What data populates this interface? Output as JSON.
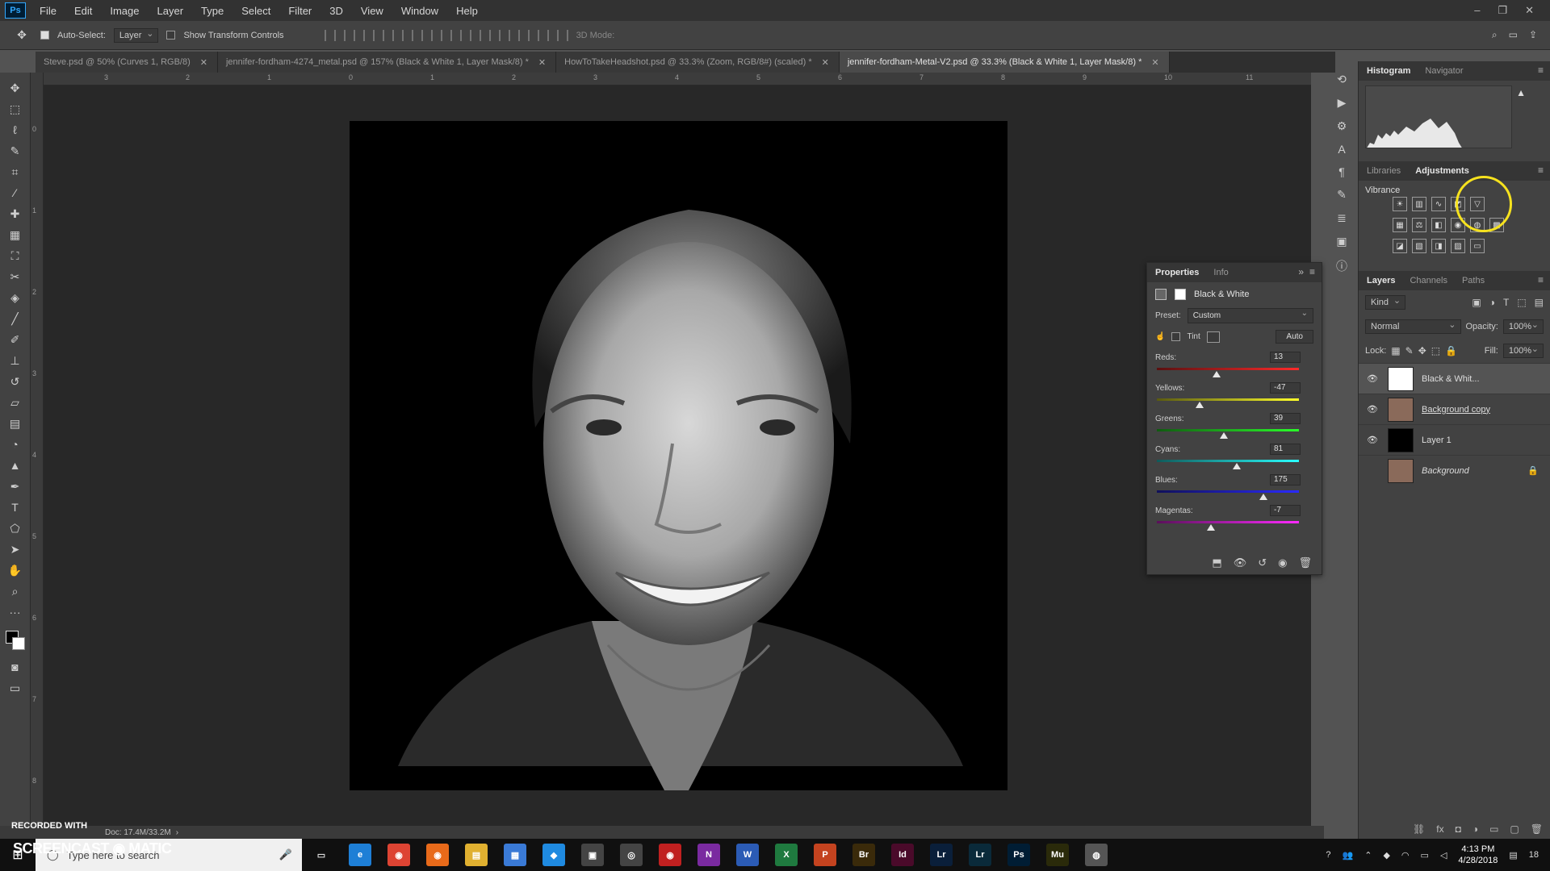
{
  "app": {
    "logo": "Ps"
  },
  "menu": [
    "File",
    "Edit",
    "Image",
    "Layer",
    "Type",
    "Select",
    "Filter",
    "3D",
    "View",
    "Window",
    "Help"
  ],
  "window_controls": [
    "–",
    "❐",
    "✕"
  ],
  "options": {
    "auto_select_label": "Auto-Select:",
    "auto_select_value": "Layer",
    "show_transform_label": "Show Transform Controls",
    "mode_3d": "3D Mode:"
  },
  "tabs": [
    {
      "label": "Steve.psd @ 50% (Curves 1, RGB/8)",
      "active": false
    },
    {
      "label": "jennifer-fordham-4274_metal.psd @ 157% (Black & White 1, Layer Mask/8) *",
      "active": false
    },
    {
      "label": "HowToTakeHeadshot.psd @ 33.3% (Zoom, RGB/8#) (scaled) *",
      "active": false
    },
    {
      "label": "jennifer-fordham-Metal-V2.psd @ 33.3% (Black & White 1, Layer Mask/8) *",
      "active": true
    }
  ],
  "ruler_h": [
    "3",
    "2",
    "1",
    "0",
    "1",
    "2",
    "3",
    "4",
    "5",
    "6",
    "7",
    "8",
    "9",
    "10",
    "11"
  ],
  "ruler_v": [
    "0",
    "1",
    "2",
    "3",
    "4",
    "5",
    "6",
    "7",
    "8"
  ],
  "status": {
    "doc": "Doc: 17.4M/33.2M"
  },
  "histogram_panel": {
    "tabs": [
      "Histogram",
      "Navigator"
    ]
  },
  "adjustments_panel": {
    "tabs": [
      "Libraries",
      "Adjustments"
    ],
    "hover_title": "Vibrance"
  },
  "layers_panel": {
    "tabs": [
      "Layers",
      "Channels",
      "Paths"
    ],
    "kind": "Kind",
    "blend": "Normal",
    "opacity_label": "Opacity:",
    "opacity_value": "100%",
    "lock_label": "Lock:",
    "fill_label": "Fill:",
    "fill_value": "100%",
    "layers": [
      {
        "name": "Black & Whit...",
        "thumb": "#ffffff",
        "visible": true,
        "selected": true,
        "italic": false,
        "underline": false
      },
      {
        "name": "Background copy",
        "thumb": "#8a6a5a",
        "visible": true,
        "selected": false,
        "italic": false,
        "underline": true
      },
      {
        "name": "Layer 1",
        "thumb": "#000000",
        "visible": true,
        "selected": false,
        "italic": false,
        "underline": false
      },
      {
        "name": "Background",
        "thumb": "#8a6a5a",
        "visible": false,
        "selected": false,
        "italic": true,
        "underline": false
      }
    ]
  },
  "properties_panel": {
    "tabs": [
      "Properties",
      "Info"
    ],
    "title": "Black & White",
    "preset_label": "Preset:",
    "preset_value": "Custom",
    "tint_label": "Tint",
    "auto_label": "Auto",
    "sliders": [
      {
        "label": "Reds:",
        "value": "13",
        "pos": 0.42,
        "gradient": "linear-gradient(90deg,#5a1010,#ff2a2a)"
      },
      {
        "label": "Yellows:",
        "value": "-47",
        "pos": 0.3,
        "gradient": "linear-gradient(90deg,#5a5a10,#ffff2a)"
      },
      {
        "label": "Greens:",
        "value": "39",
        "pos": 0.47,
        "gradient": "linear-gradient(90deg,#105a10,#2aff2a)"
      },
      {
        "label": "Cyans:",
        "value": "81",
        "pos": 0.56,
        "gradient": "linear-gradient(90deg,#105a5a,#2affff)"
      },
      {
        "label": "Blues:",
        "value": "175",
        "pos": 0.75,
        "gradient": "linear-gradient(90deg,#10105a,#2a2aff)"
      },
      {
        "label": "Magentas:",
        "value": "-7",
        "pos": 0.38,
        "gradient": "linear-gradient(90deg,#5a105a,#ff2aff)"
      }
    ]
  },
  "taskbar": {
    "search_placeholder": "Type here to search",
    "time": "4:13 PM",
    "date": "4/28/2018",
    "apps": [
      {
        "label": "e",
        "color": "#1e7fd6"
      },
      {
        "label": "◉",
        "color": "#dd4433"
      },
      {
        "label": "◉",
        "color": "#e86a1a"
      },
      {
        "label": "▤",
        "color": "#e0b030"
      },
      {
        "label": "▦",
        "color": "#3a7ad6"
      },
      {
        "label": "◆",
        "color": "#1f8ae0"
      },
      {
        "label": "▣",
        "color": "#444444"
      },
      {
        "label": "◎",
        "color": "#444444"
      },
      {
        "label": "◉",
        "color": "#c02020"
      },
      {
        "label": "N",
        "color": "#7a2aa0"
      },
      {
        "label": "W",
        "color": "#2b5bb5"
      },
      {
        "label": "X",
        "color": "#1f7a3f"
      },
      {
        "label": "P",
        "color": "#c4431f"
      },
      {
        "label": "Br",
        "color": "#3a2a0a"
      },
      {
        "label": "Id",
        "color": "#4a0a2a"
      },
      {
        "label": "Lr",
        "color": "#0a1f3a"
      },
      {
        "label": "Lr",
        "color": "#0a2a3a"
      },
      {
        "label": "Ps",
        "color": "#001d34"
      },
      {
        "label": "Mu",
        "color": "#2a2a0a"
      },
      {
        "label": "◍",
        "color": "#555555"
      }
    ],
    "notif_count": "18"
  },
  "watermark": {
    "line1": "RECORDED WITH",
    "line2": "SCREENCAST ◉ MATIC"
  }
}
